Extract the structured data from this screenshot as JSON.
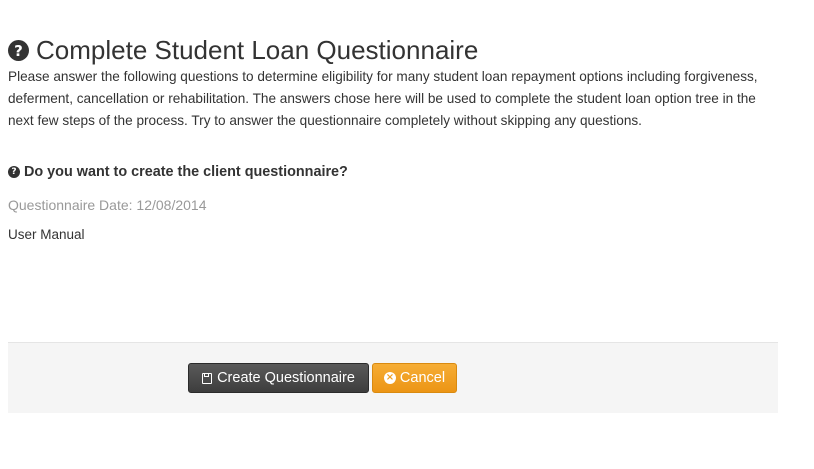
{
  "page": {
    "title": "Complete Student Loan Questionnaire",
    "title_icon": "question-circle-icon",
    "intro": "Please answer the following questions to determine eligibility for many student loan repayment options including forgiveness, deferment, cancellation or rehabilitation. The answers chose here will be used to complete the student loan option tree in the next few steps of the process. Try to answer the questionnaire completely without skipping any questions.",
    "question": "Do you want to create the client questionnaire?",
    "question_date": "Questionnaire Date: 12/08/2014",
    "user_manual": "User Manual"
  },
  "footer": {
    "create_label": "Create Questionnaire",
    "create_icon": "save-icon",
    "cancel_label": "Cancel",
    "cancel_icon": "times-circle-icon"
  },
  "colors": {
    "text": "#333333",
    "muted": "#999999",
    "create_button": "#4a4a4a",
    "cancel_button": "#f0a023",
    "footer_bg": "#f5f5f5"
  }
}
